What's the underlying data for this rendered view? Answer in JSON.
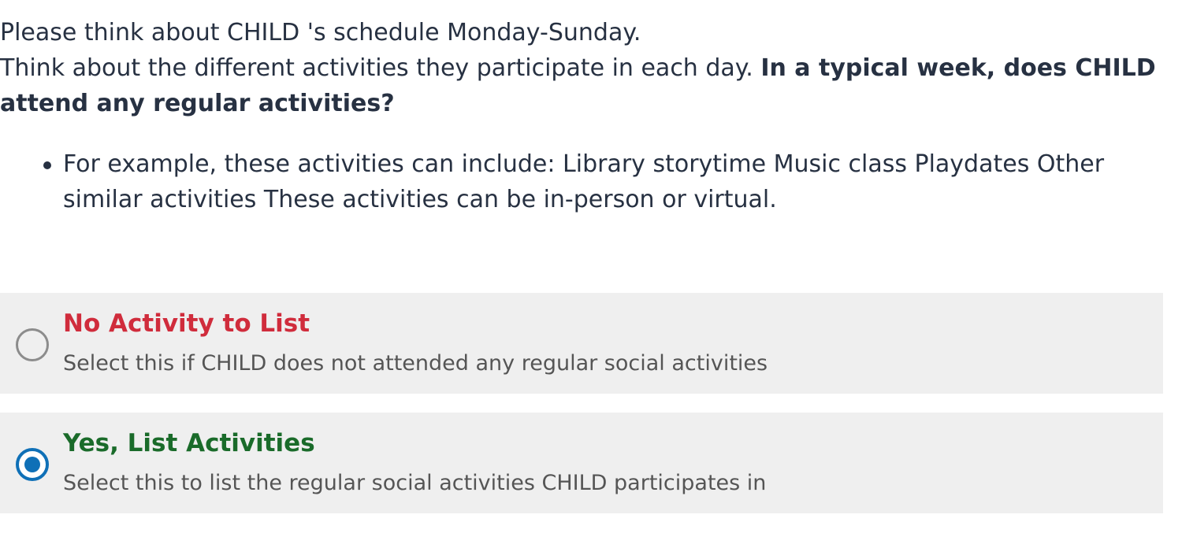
{
  "question": {
    "line1": "Please think about CHILD 's schedule Monday-Sunday.",
    "line2_plain": "Think about the different activities they participate in each day. ",
    "line2_bold": "In a typical week, does CHILD attend any regular activities?"
  },
  "examples": {
    "text": "For example, these activities can include: Library storytime Music class Playdates Other similar activities These activities can be in-person or virtual."
  },
  "options": [
    {
      "title": "No Activity to List",
      "description": "Select this if CHILD does not attended any regular social activities",
      "selected": false,
      "title_color": "#d02c3c"
    },
    {
      "title": "Yes, List Activities",
      "description": "Select this to list the regular social activities CHILD participates in",
      "selected": true,
      "title_color": "#1a6b2a"
    }
  ],
  "colors": {
    "text": "#273142",
    "option_background": "#efefef",
    "radio_selected": "#0f70b7",
    "radio_unselected": "#8c8c8c"
  }
}
